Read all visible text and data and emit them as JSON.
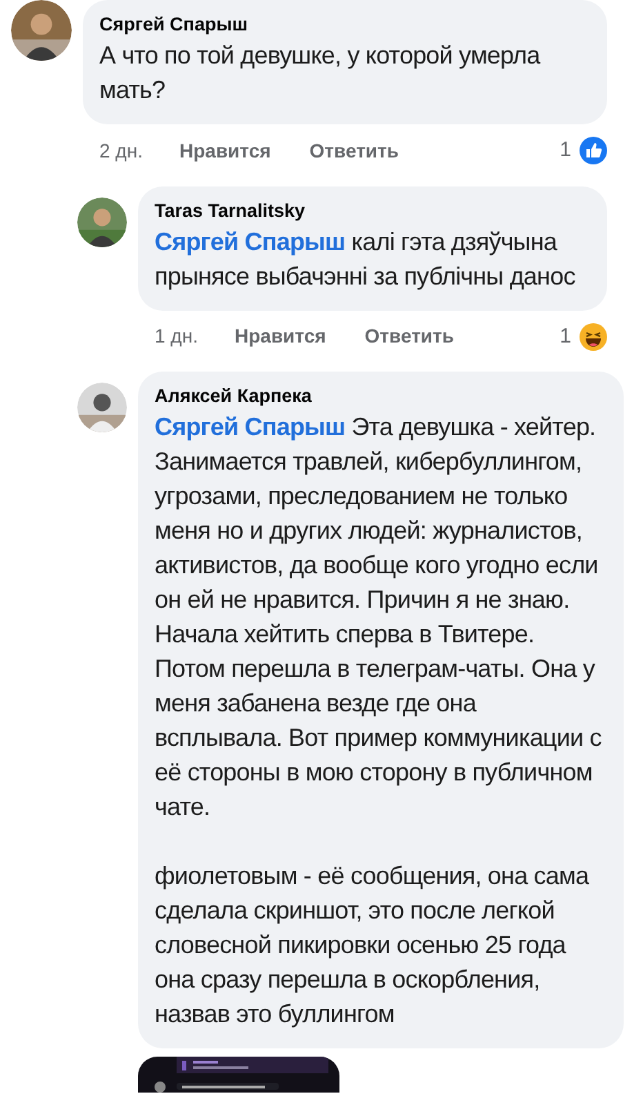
{
  "comments": [
    {
      "author": "Сяргей Спарыш",
      "reply": false,
      "paragraphs": [
        "А что по той девушке, у которой умерла мать?"
      ],
      "time": "2 дн.",
      "like_label": "Нравится",
      "reply_label": "Ответить",
      "reaction_count": "1",
      "kind": "like"
    },
    {
      "author": "Taras Tarnalitsky",
      "reply": true,
      "mention": "Сяргей Спарыш",
      "paragraphs": [
        "калі гэта дзяўчына прынясе выбачэнні за публічны данос"
      ],
      "time": "1 дн.",
      "like_label": "Нравится",
      "reply_label": "Ответить",
      "reaction_count": "1",
      "kind": "haha"
    },
    {
      "author": "Аляксей Карпека",
      "reply": true,
      "mention": "Сяргей Спарыш",
      "paragraphs": [
        "Эта девушка - хейтер. Занимается травлей, кибербуллингом, угрозами, преследованием не только меня но и других людей: журналистов, активистов, да вообще кого угодно если он ей не нравится. Причин я не знаю. Начала хейтить сперва в Твитере. Потом перешла в телеграм-чаты. Она у меня забанена везде где она всплывала. Вот пример коммуникации с её стороны в мою сторону в публичном чате.",
        "фиолетовым - её сообщения, она сама сделала скриншот, это после легкой словесной пикировки осенью 25 года она сразу перешла в оскорбления, назвав это буллингом"
      ],
      "attachment": {
        "kind": "picture"
      }
    }
  ]
}
